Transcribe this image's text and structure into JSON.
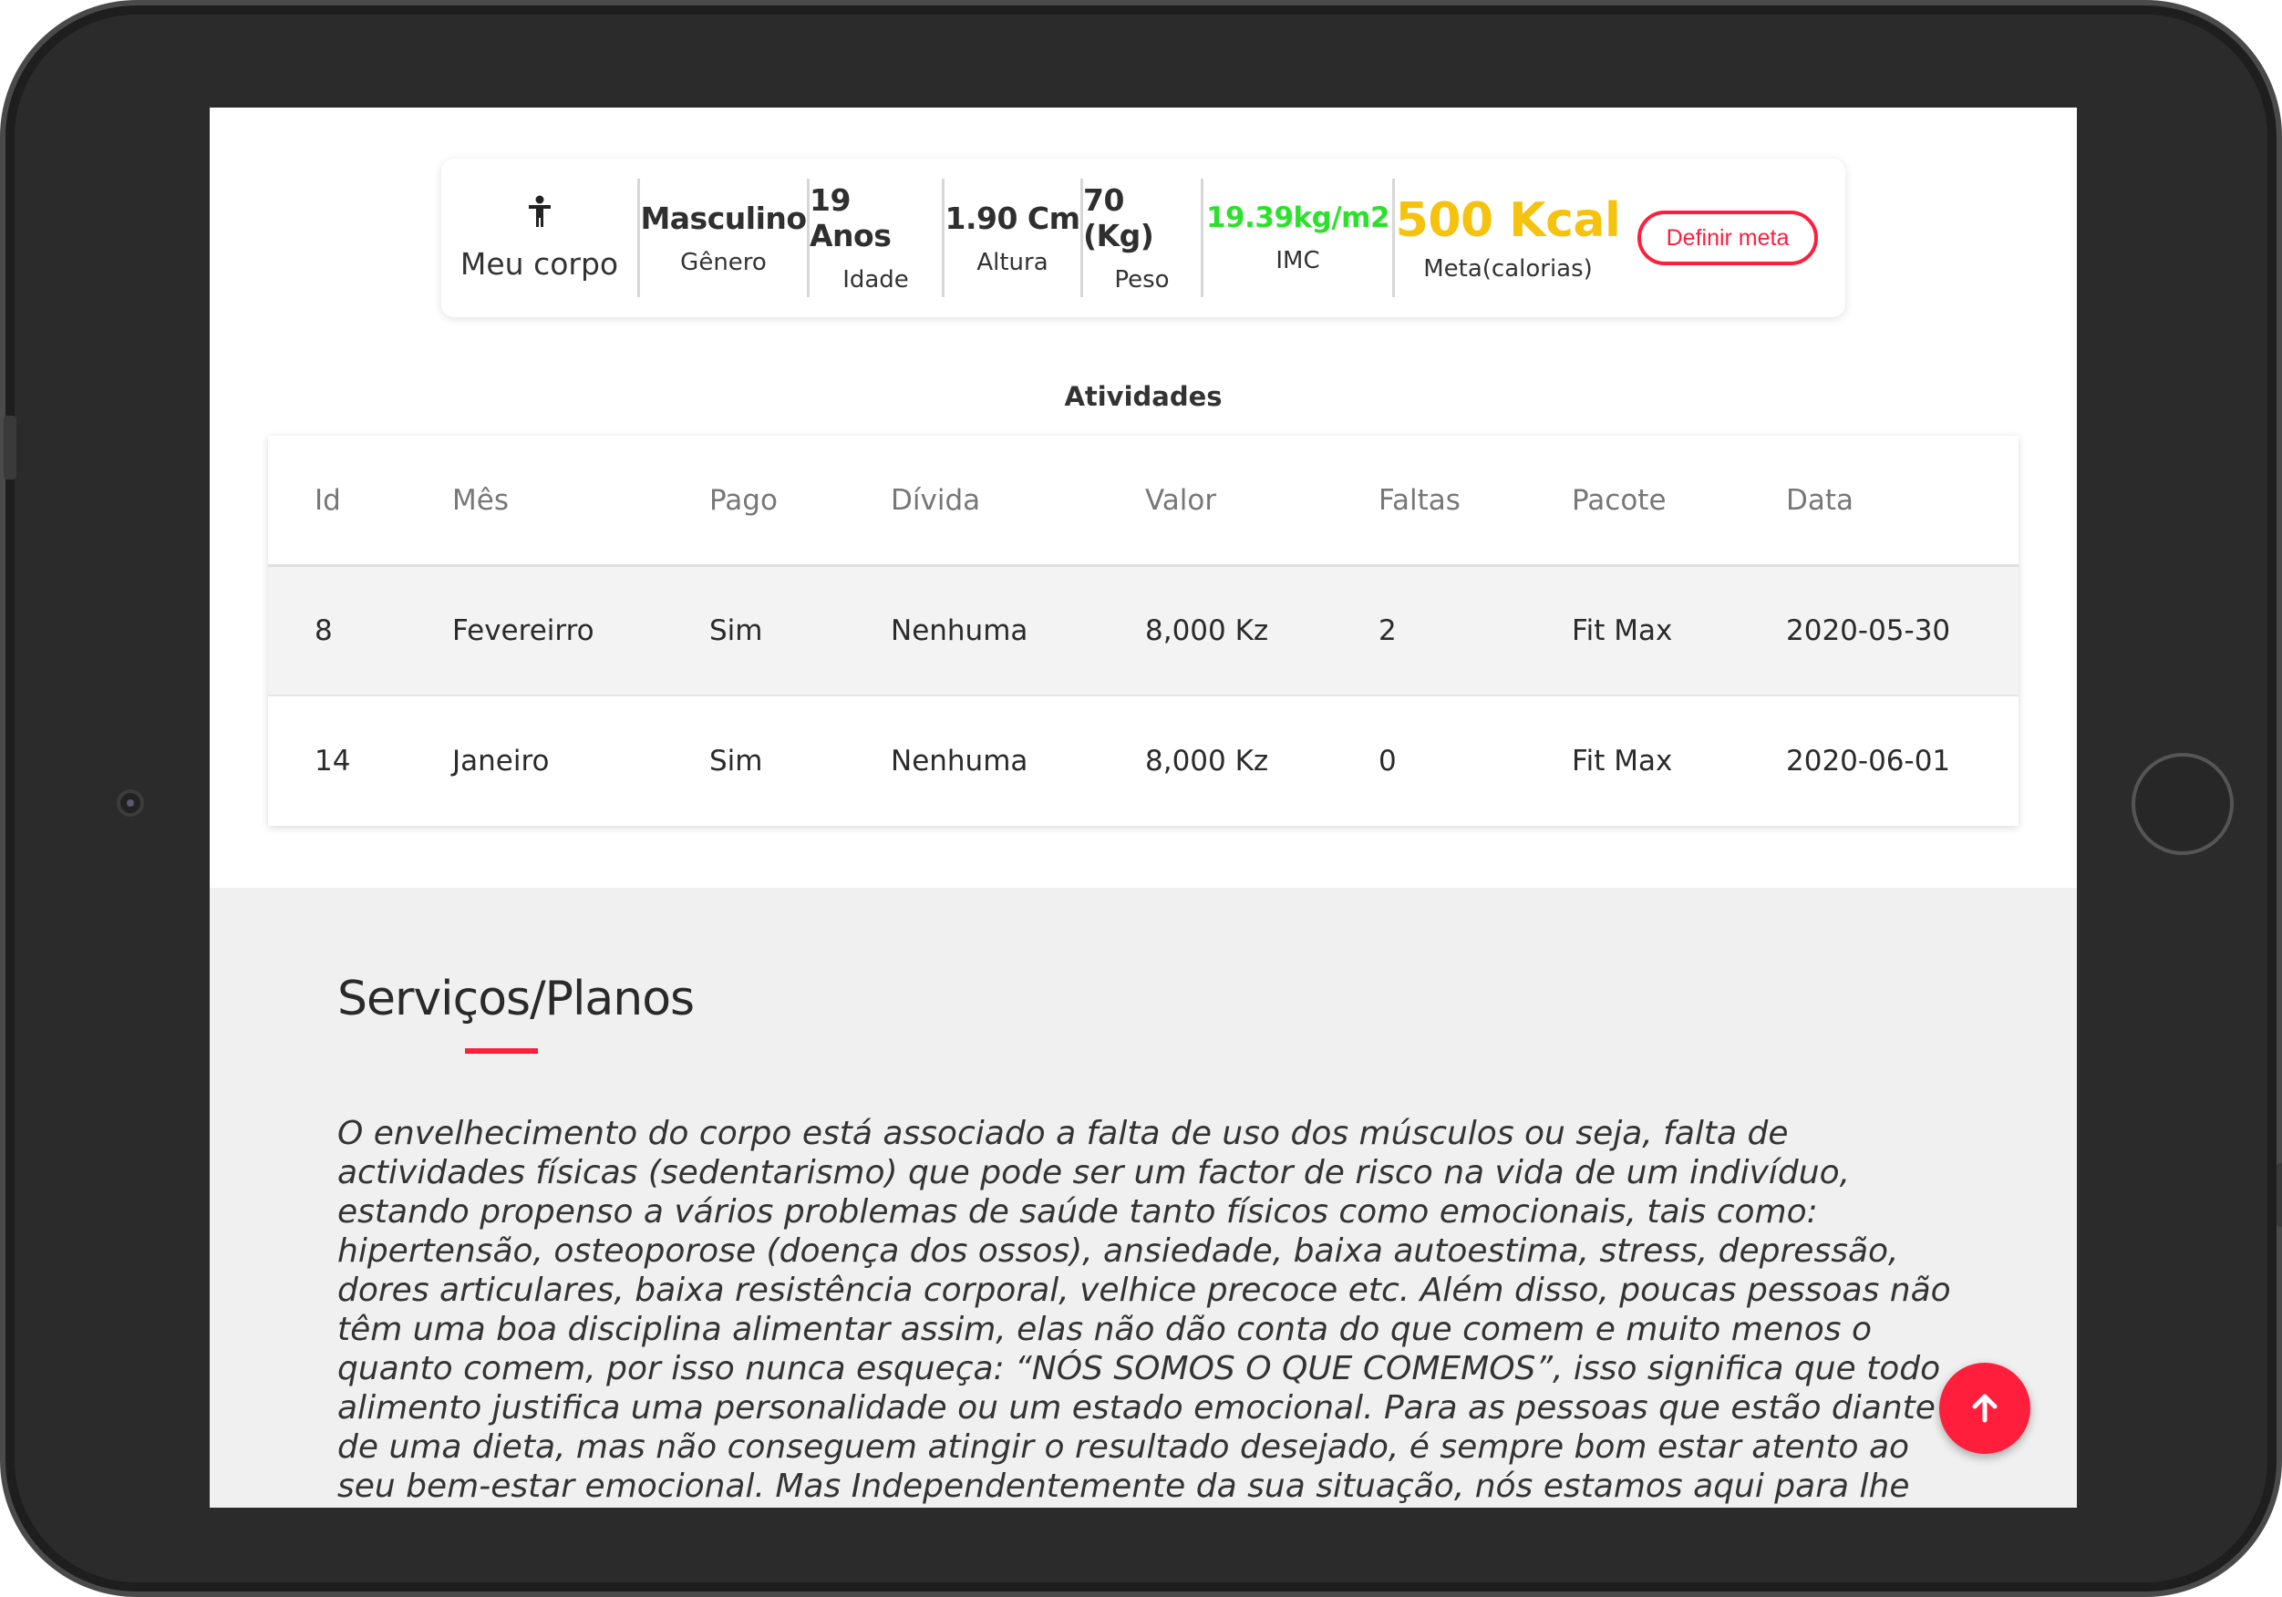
{
  "body_summary": {
    "icon": "child-icon",
    "label": "Meu corpo",
    "stats": [
      {
        "value": "Masculino",
        "label": "Gênero"
      },
      {
        "value": "19 Anos",
        "label": "Idade"
      },
      {
        "value": "1.90 Cm",
        "label": "Altura"
      },
      {
        "value": "70 (Kg)",
        "label": "Peso"
      },
      {
        "value": "19.39kg/m2",
        "label": "IMC"
      },
      {
        "value": "500 Kcal",
        "label": "Meta(calorias)"
      }
    ],
    "goal_button_label": "Definir meta"
  },
  "activities": {
    "title": "Atividades",
    "columns": [
      "Id",
      "Mês",
      "Pago",
      "Dívida",
      "Valor",
      "Faltas",
      "Pacote",
      "Data"
    ],
    "rows": [
      [
        "8",
        "Fevereirro",
        "Sim",
        "Nenhuma",
        "8,000 Kz",
        "2",
        "Fit Max",
        "2020-05-30"
      ],
      [
        "14",
        "Janeiro",
        "Sim",
        "Nenhuma",
        "8,000 Kz",
        "0",
        "Fit Max",
        "2020-06-01"
      ]
    ]
  },
  "services": {
    "title": "Serviços/Planos",
    "text": "O envelhecimento do corpo está associado a falta de uso dos músculos ou seja, falta de actividades físicas (sedentarismo) que pode ser um factor de risco na vida de um indivíduo, estando propenso a vários problemas de saúde tanto físicos como emocionais, tais como: hipertensão, osteoporose (doença dos ossos), ansiedade, baixa autoestima, stress, depressão, dores articulares, baixa resistência corporal, velhice precoce etc. Além disso, poucas pessoas não têm uma boa disciplina alimentar assim, elas não dão conta do que comem e muito menos o quanto comem, por isso nunca esqueça: “NÓS SOMOS O QUE COMEMOS”, isso significa que todo alimento justifica uma personalidade ou um estado emocional. Para as pessoas que estão diante de uma dieta, mas não conseguem atingir o resultado desejado, é sempre bom estar atento ao seu bem-estar emocional. Mas Independentemente da sua situação, nós estamos aqui para lhe fornecer os melhores serviços"
  },
  "scroll_top_icon": "arrow-up-icon",
  "colors": {
    "accent": "#ff1e3c",
    "bmi": "#2ee02e",
    "goal": "#f5c20d",
    "section_bg": "#f0f0f0"
  }
}
